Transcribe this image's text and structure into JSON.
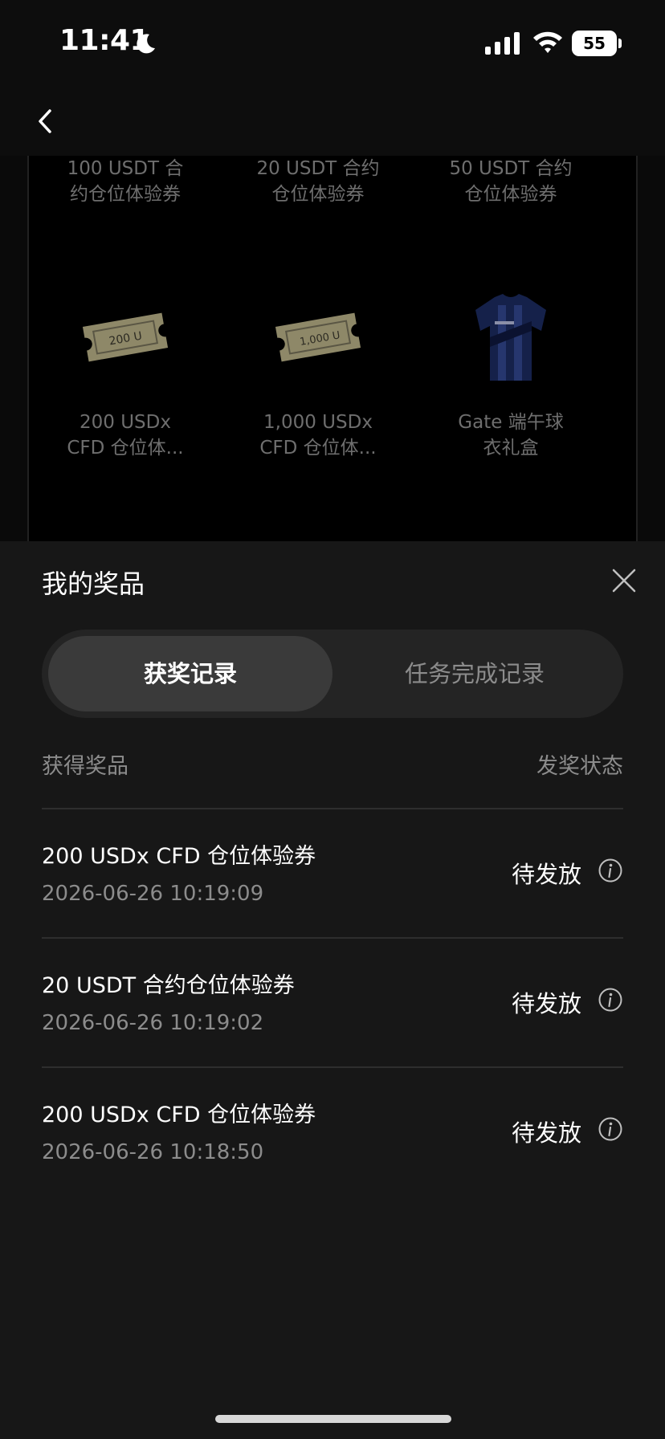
{
  "status_bar": {
    "time": "11:41",
    "battery": "55"
  },
  "prizes": [
    {
      "label": "100 USDT 合\n约仓位体验券",
      "icon": "voucher-icon"
    },
    {
      "label": "20 USDT 合约\n仓位体验券",
      "icon": "voucher-icon"
    },
    {
      "label": "50 USDT 合约\n仓位体验券",
      "icon": "voucher-icon"
    },
    {
      "label": "200 USDx\nCFD 仓位体...",
      "icon": "ticket-icon",
      "ticket_text": "200 U"
    },
    {
      "label": "1,000 USDx\nCFD 仓位体...",
      "icon": "ticket-icon",
      "ticket_text": "1,000 U"
    },
    {
      "label": "Gate 端午球\n衣礼盒",
      "icon": "jersey-icon"
    }
  ],
  "sheet": {
    "title": "我的奖品",
    "tabs": [
      {
        "label": "获奖记录",
        "active": true
      },
      {
        "label": "任务完成记录",
        "active": false
      }
    ],
    "columns": {
      "prize": "获得奖品",
      "status": "发奖状态"
    },
    "records": [
      {
        "name": "200 USDx CFD 仓位体验券",
        "time": "2026-06-26 10:19:09",
        "status": "待发放"
      },
      {
        "name": "20 USDT 合约仓位体验券",
        "time": "2026-06-26 10:19:02",
        "status": "待发放"
      },
      {
        "name": "200 USDx CFD 仓位体验券",
        "time": "2026-06-26 10:18:50",
        "status": "待发放"
      }
    ]
  },
  "colors": {
    "background": "#0a0a0a",
    "sheet": "#171717",
    "tab_active": "#3a3a3a",
    "text_muted": "#8c8c8c"
  }
}
